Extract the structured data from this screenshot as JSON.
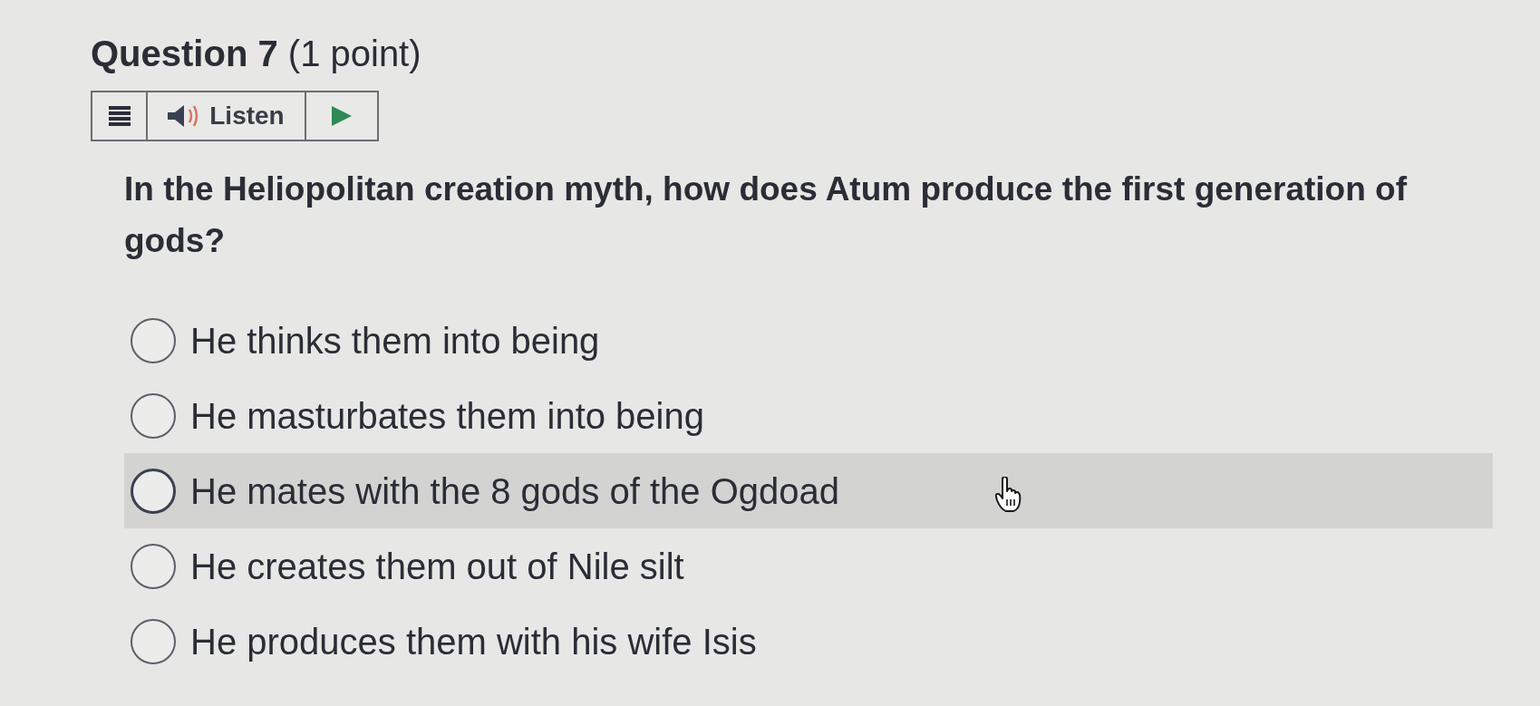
{
  "question": {
    "title": "**Question 7** (1 point)",
    "text": "In the Heliopolitan creation myth, how does Atum produce the first generation of gods?"
  },
  "listen_bar": {
    "label": "Listen"
  },
  "options": [
    {
      "label": "He thinks them into being",
      "selected": false,
      "hovered": false
    },
    {
      "label": "He masturbates them into being",
      "selected": false,
      "hovered": false
    },
    {
      "label": "He mates with the 8 gods of the Ogdoad",
      "selected": false,
      "hovered": true
    },
    {
      "label": "He creates them out of Nile silt",
      "selected": false,
      "hovered": false
    },
    {
      "label": "He produces them with his wife Isis",
      "selected": false,
      "hovered": false
    }
  ]
}
